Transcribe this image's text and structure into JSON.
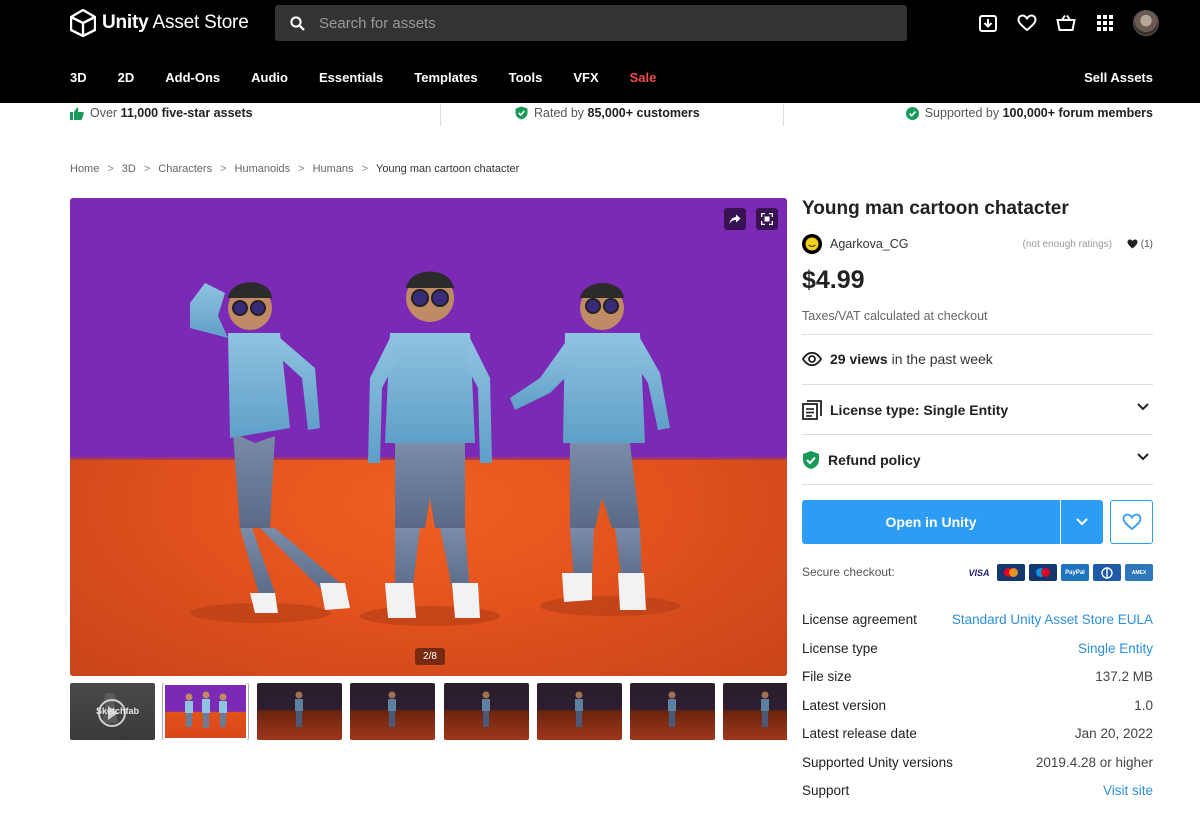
{
  "header": {
    "logo_text_bold": "Unity",
    "logo_text_rest": " Asset Store",
    "search_placeholder": "Search for assets",
    "icons": [
      "download-icon",
      "heart-icon",
      "cart-icon",
      "apps-grid-icon",
      "avatar"
    ]
  },
  "nav": {
    "items": [
      "3D",
      "2D",
      "Add-Ons",
      "Audio",
      "Essentials",
      "Templates",
      "Tools",
      "VFX",
      "Sale"
    ],
    "sell_label": "Sell Assets"
  },
  "trust": {
    "item1_pre": "Over ",
    "item1_bold": "11,000 five-star assets",
    "item2_pre": "Rated by ",
    "item2_bold": "85,000+ customers",
    "item3_pre": "Supported by ",
    "item3_bold": "100,000+ forum members"
  },
  "breadcrumb": [
    "Home",
    "3D",
    "Characters",
    "Humanoids",
    "Humans",
    "Young man cartoon chatacter"
  ],
  "gallery": {
    "counter": "2/8",
    "thumb_badge": "Sketchfab"
  },
  "product": {
    "title": "Young man cartoon chatacter",
    "publisher": "Agarkova_CG",
    "ratings_note": "(not enough ratings)",
    "favorites": "(1)",
    "price": "$4.99",
    "tax_note": "Taxes/VAT calculated at checkout",
    "views_count": "29 views",
    "views_suffix": "in the past week",
    "license_label": "License type: Single Entity",
    "refund_label": "Refund policy",
    "open_button": "Open in Unity",
    "secure_checkout": "Secure checkout:",
    "payment_cards": [
      "VISA",
      "mastercard",
      "maestro",
      "PayPal",
      "diners",
      "amex"
    ]
  },
  "details": [
    {
      "k": "License agreement",
      "v": "Standard Unity Asset Store EULA"
    },
    {
      "k": "License type",
      "v": "Single Entity"
    },
    {
      "k": "File size",
      "v": "137.2 MB"
    },
    {
      "k": "Latest version",
      "v": "1.0"
    },
    {
      "k": "Latest release date",
      "v": "Jan 20, 2022"
    },
    {
      "k": "Supported Unity versions",
      "v": "2019.4.28 or higher"
    },
    {
      "k": "Support",
      "v": "Visit site"
    }
  ],
  "colors": {
    "accent": "#2d9cf4",
    "sale": "#f24d4d",
    "link": "#2d8fdc",
    "check": "#1a9a5a"
  }
}
